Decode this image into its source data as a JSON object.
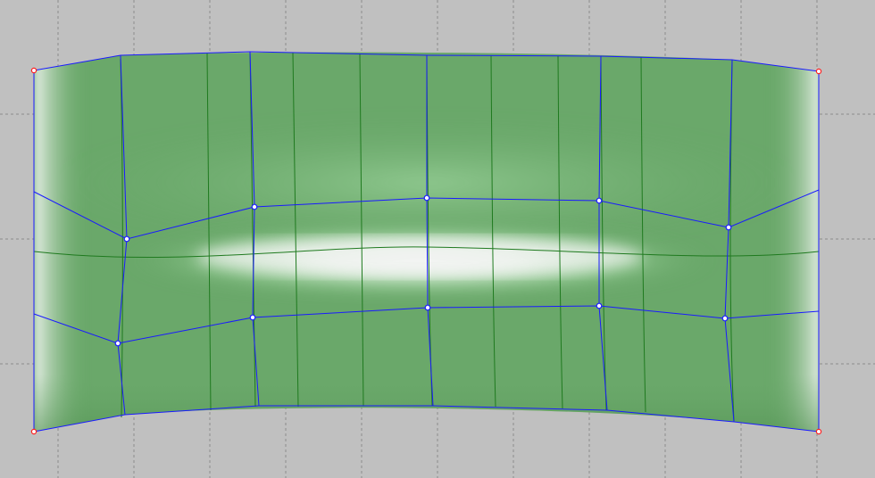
{
  "viewport": {
    "background": "#c0c0c0",
    "grid_color": "#8c8c8c",
    "grid_style": "dashed"
  },
  "surface": {
    "fill_color": "#6aa86a",
    "highlight_color": "#f0f0f0",
    "iso_curve_color": "#1f7a1f",
    "control_net_color": "#1a1aff",
    "corner_point_color": "#ff2020",
    "control_point_fill": "#ffffff",
    "shading": "smooth"
  },
  "icons": {
    "corner_point": "red-circle",
    "control_point": "blue-circle"
  }
}
